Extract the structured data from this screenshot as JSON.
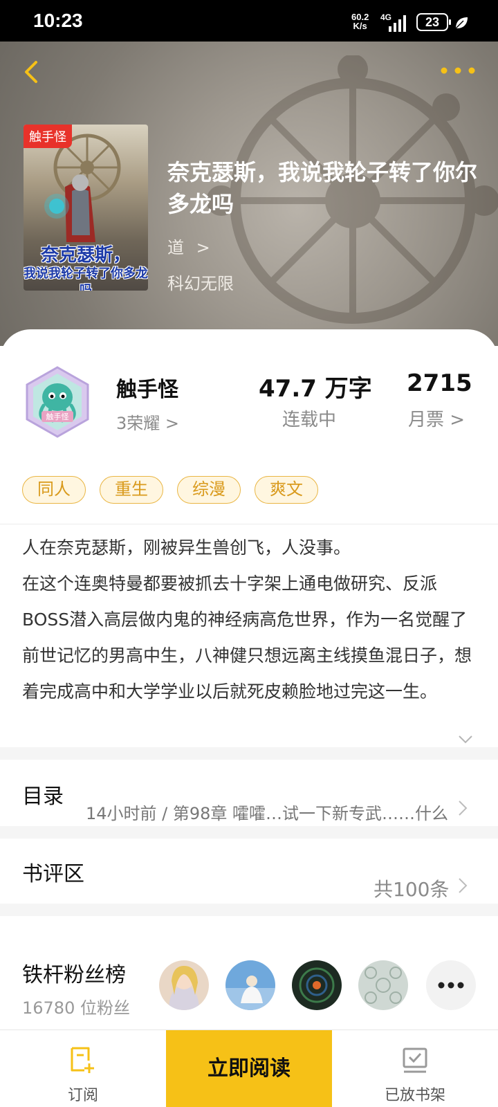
{
  "status_bar": {
    "time": "10:23",
    "net_speed_value": "60.2",
    "net_speed_unit": "K/s",
    "network_type": "4G",
    "battery": "23"
  },
  "header": {
    "cover_badge": "触手怪",
    "cover_title_line1": "奈克瑟斯，",
    "cover_title_line2": "我说我轮子转了你多龙吗",
    "title": "奈克瑟斯，我说我轮子转了你尔多龙吗",
    "author": "道",
    "author_arrow": ">",
    "category": "科幻无限"
  },
  "author_info": {
    "avatar_text": "触手怪",
    "name": "触手怪",
    "honor": "3荣耀 >"
  },
  "stats": {
    "word_count": "47.7 万字",
    "status": "连载中",
    "monthly_tickets": "2715",
    "monthly_label": "月票 >"
  },
  "tags": [
    "同人",
    "重生",
    "综漫",
    "爽文"
  ],
  "intro": {
    "line1": "人在奈克瑟斯，刚被异生兽创飞，人没事。",
    "rest": "在这个连奥特曼都要被抓去十字架上通电做研究、反派BOSS潜入高层做内鬼的神经病高危世界，作为一名觉醒了前世记忆的男高中生，八神健只想远离主线摸鱼混日子，想着完成高中和大学学业以后就死皮赖脸地过完这一生。"
  },
  "toc": {
    "label": "目录",
    "latest": "14小时前 / 第98章 嚯嚯…试一下新专武……什么"
  },
  "reviews": {
    "label": "书评区",
    "count": "共100条"
  },
  "fans": {
    "label": "铁杆粉丝榜",
    "count": "16780 位粉丝"
  },
  "bottom_bar": {
    "subscribe_label": "订阅",
    "read_label": "立即阅读",
    "shelf_label": "已放书架"
  },
  "colors": {
    "accent": "#F6C117",
    "tag_border": "#E9B542",
    "tag_text": "#D99A1C",
    "badge_red": "#E8322A"
  },
  "icons": [
    "back-icon",
    "more-icon",
    "chevron-right-icon",
    "chevron-down-icon",
    "subscribe-icon",
    "bookshelf-icon",
    "signal-icon",
    "leaf-icon"
  ]
}
